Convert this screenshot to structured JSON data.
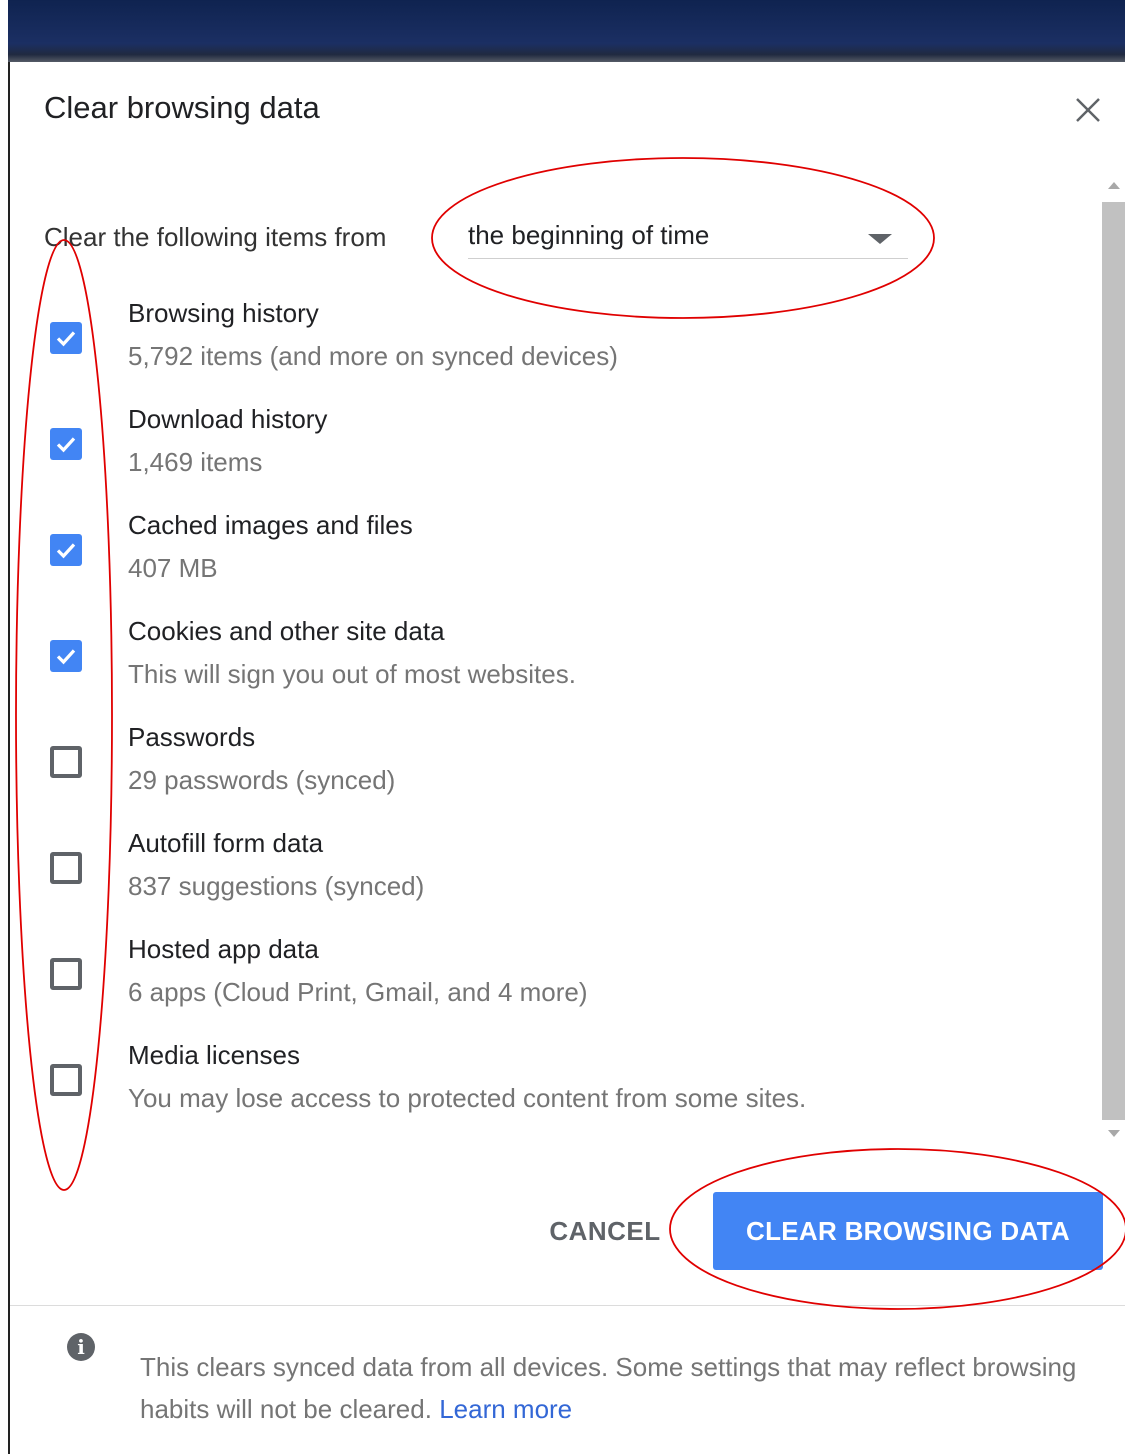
{
  "dialog": {
    "title": "Clear browsing data",
    "close_icon": "close-icon"
  },
  "time_range": {
    "label": "Clear the following items from",
    "selected": "the beginning of time",
    "arrow_icon": "dropdown-arrow-icon"
  },
  "items": [
    {
      "label": "Browsing history",
      "detail": "5,792 items (and more on synced devices)",
      "checked": true
    },
    {
      "label": "Download history",
      "detail": "1,469 items",
      "checked": true
    },
    {
      "label": "Cached images and files",
      "detail": "407 MB",
      "checked": true
    },
    {
      "label": "Cookies and other site data",
      "detail": "This will sign you out of most websites.",
      "checked": true
    },
    {
      "label": "Passwords",
      "detail": "29 passwords (synced)",
      "checked": false
    },
    {
      "label": "Autofill form data",
      "detail": "837 suggestions (synced)",
      "checked": false
    },
    {
      "label": "Hosted app data",
      "detail": "6 apps (Cloud Print, Gmail, and 4 more)",
      "checked": false
    },
    {
      "label": "Media licenses",
      "detail": "You may lose access to protected content from some sites.",
      "checked": false
    }
  ],
  "actions": {
    "cancel": "CANCEL",
    "clear": "CLEAR BROWSING DATA"
  },
  "footer": {
    "info_icon": "info-icon",
    "text": "This clears synced data from all devices. Some settings that may reflect browsing habits will not be cleared.",
    "link": "Learn more"
  },
  "colors": {
    "accent": "#4285f4",
    "link": "#3367d6",
    "annotation": "#e00000",
    "header_bar": "#1b2f63"
  }
}
